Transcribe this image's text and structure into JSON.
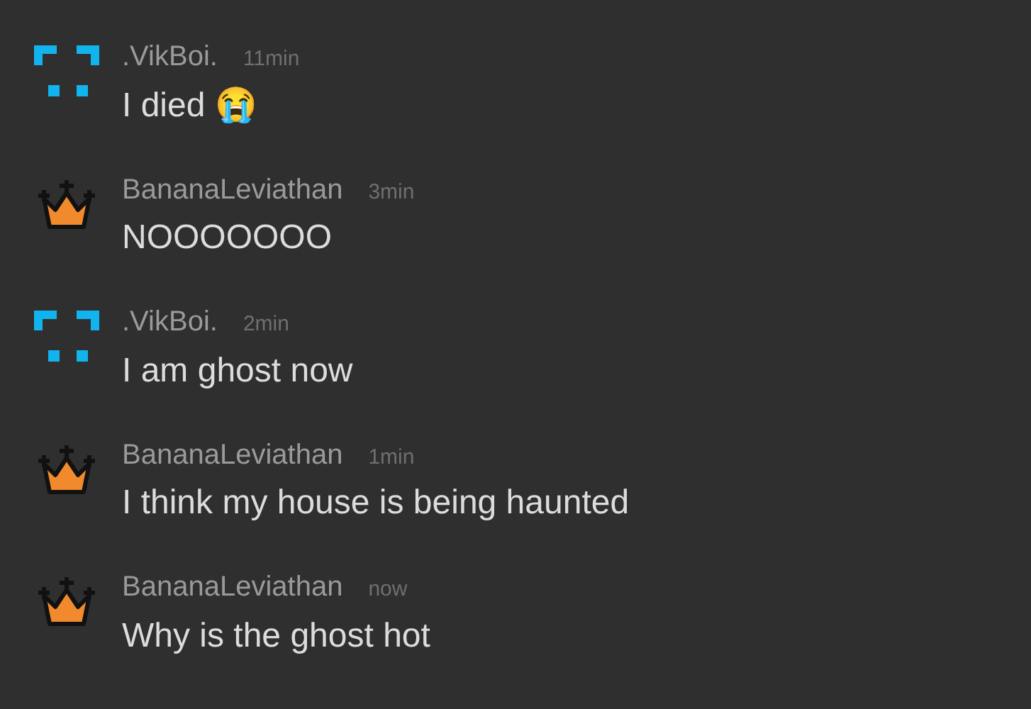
{
  "messages": [
    {
      "kind": "pixel",
      "author": ".VikBoi.",
      "time": "11min",
      "text": "I died 😭"
    },
    {
      "kind": "crown",
      "author": "BananaLeviathan",
      "time": "3min",
      "text": "NOOOOOOO"
    },
    {
      "kind": "pixel",
      "author": ".VikBoi.",
      "time": "2min",
      "text": "I am ghost now"
    },
    {
      "kind": "crown",
      "author": "BananaLeviathan",
      "time": "1min",
      "text": "I think my house is being haunted"
    },
    {
      "kind": "crown",
      "author": "BananaLeviathan",
      "time": "now",
      "text": "Why is the ghost hot"
    }
  ]
}
